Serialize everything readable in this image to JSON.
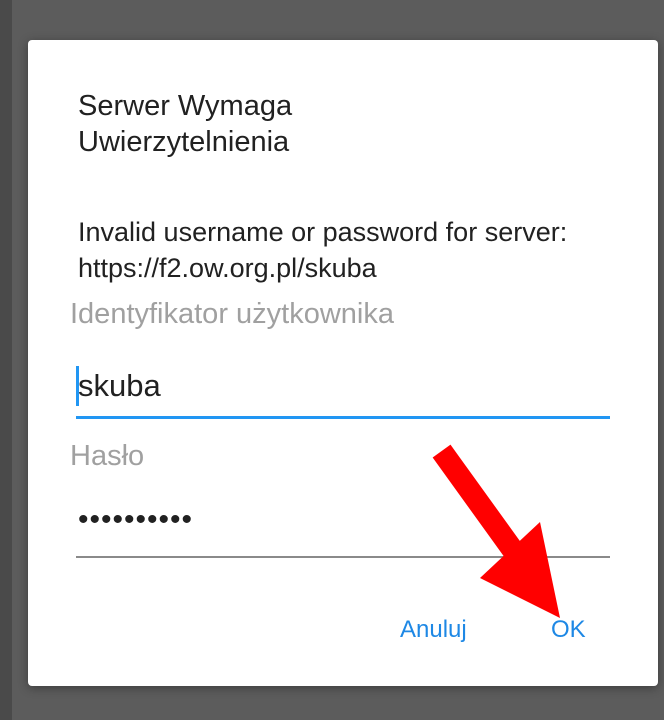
{
  "dialog": {
    "title": "Serwer Wymaga Uwierzytelnienia",
    "message": "Invalid username or password for server: https://f2.ow.org.pl/skuba",
    "username": {
      "label": "Identyfikator użytkownika",
      "value": "skuba"
    },
    "password": {
      "label": "Hasło",
      "value": "••••••••••"
    },
    "buttons": {
      "cancel_label": "Anuluj",
      "ok_label": "OK"
    }
  },
  "annotation": {
    "arrow_color": "#ff0000",
    "icon": "red-arrow-icon"
  },
  "colors": {
    "accent": "#2196f3",
    "button_text": "#1e88e5",
    "backdrop": "#5c5c5c"
  }
}
